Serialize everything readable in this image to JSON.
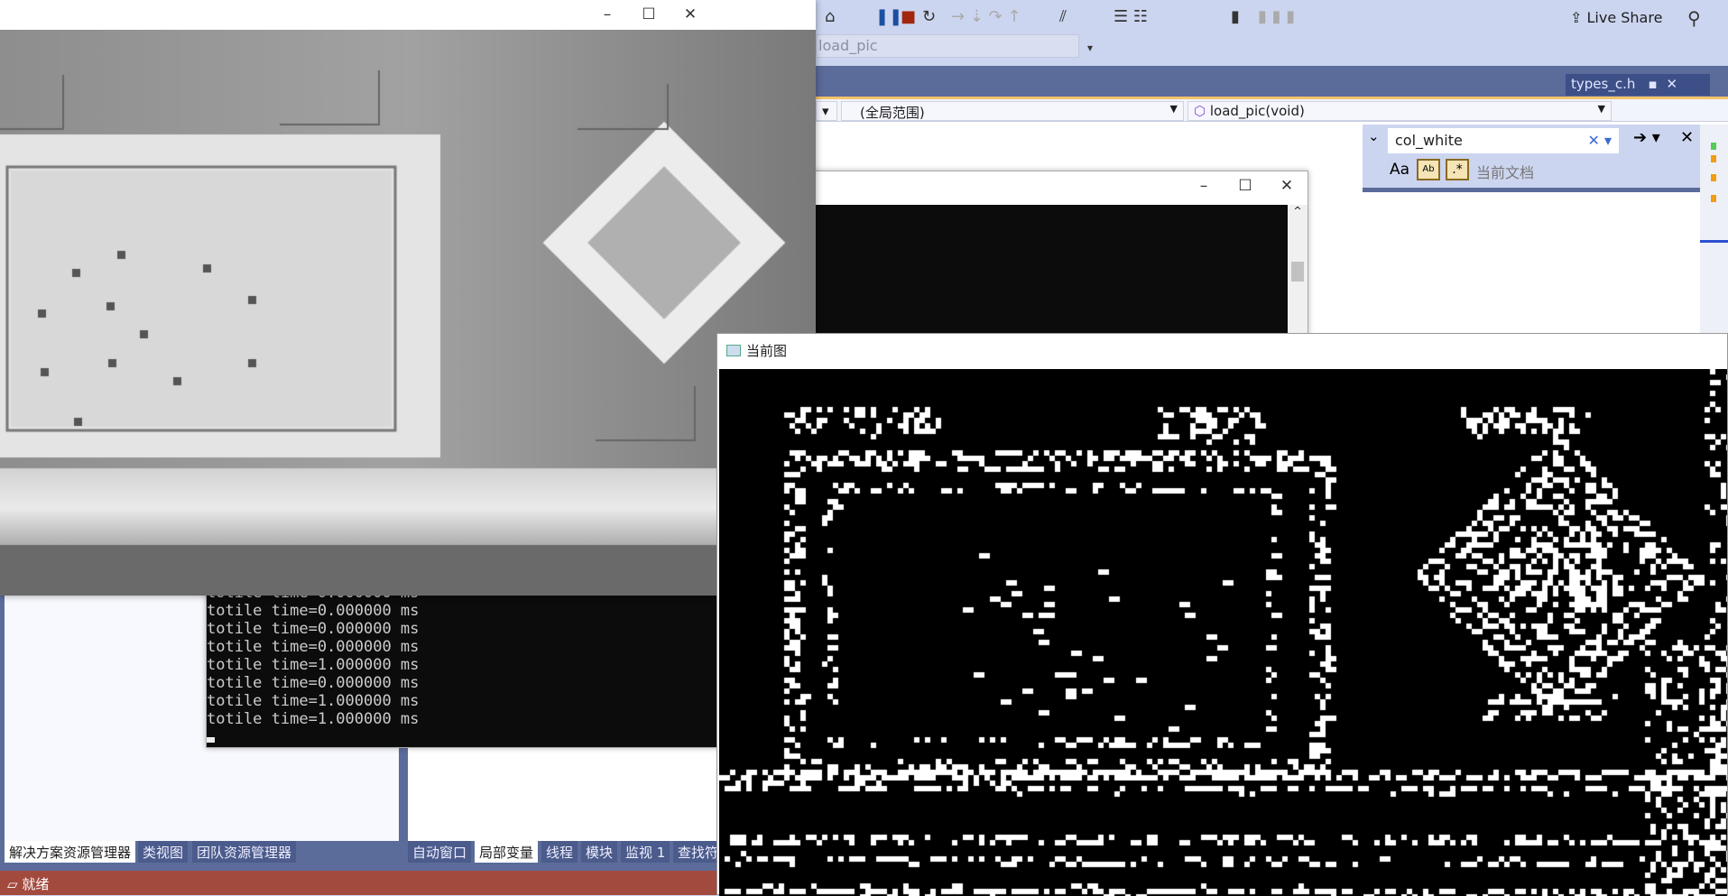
{
  "toolbar": {
    "live_share": "Live Share",
    "config_value": "load_pic",
    "icons": [
      "home-icon",
      "pause-icon",
      "stop-icon",
      "restart-icon",
      "step-icon",
      "bookmark-icon"
    ]
  },
  "doc_tab": {
    "label": "types_c.h"
  },
  "navbar": {
    "scope": "(全局范围)",
    "function": "load_pic(void)"
  },
  "find": {
    "query": "col_white",
    "match_case": "Aa",
    "scope": "当前文档"
  },
  "console": {
    "lines": [
      "totile time=0.000000 ms",
      "totile time=0.000000 ms",
      "totile time=0.000000 ms",
      "totile time=0.000000 ms",
      "totile time=1.000000 ms",
      "totile time=0.000000 ms",
      "totile time=1.000000 ms",
      "totile time=1.000000 ms"
    ]
  },
  "binary_window": {
    "title": "当前图"
  },
  "left_tabs": [
    "解决方案资源管理器",
    "类视图",
    "团队资源管理器"
  ],
  "mid_tabs": [
    "自动窗口",
    "局部变量",
    "线程",
    "模块",
    "监视 1",
    "查找符"
  ],
  "status": {
    "text": "就绪"
  },
  "colors": {
    "status_bar": "#a34a3f",
    "toolbar": "#ccd5f0",
    "tabstrip": "#5b6b9a"
  }
}
